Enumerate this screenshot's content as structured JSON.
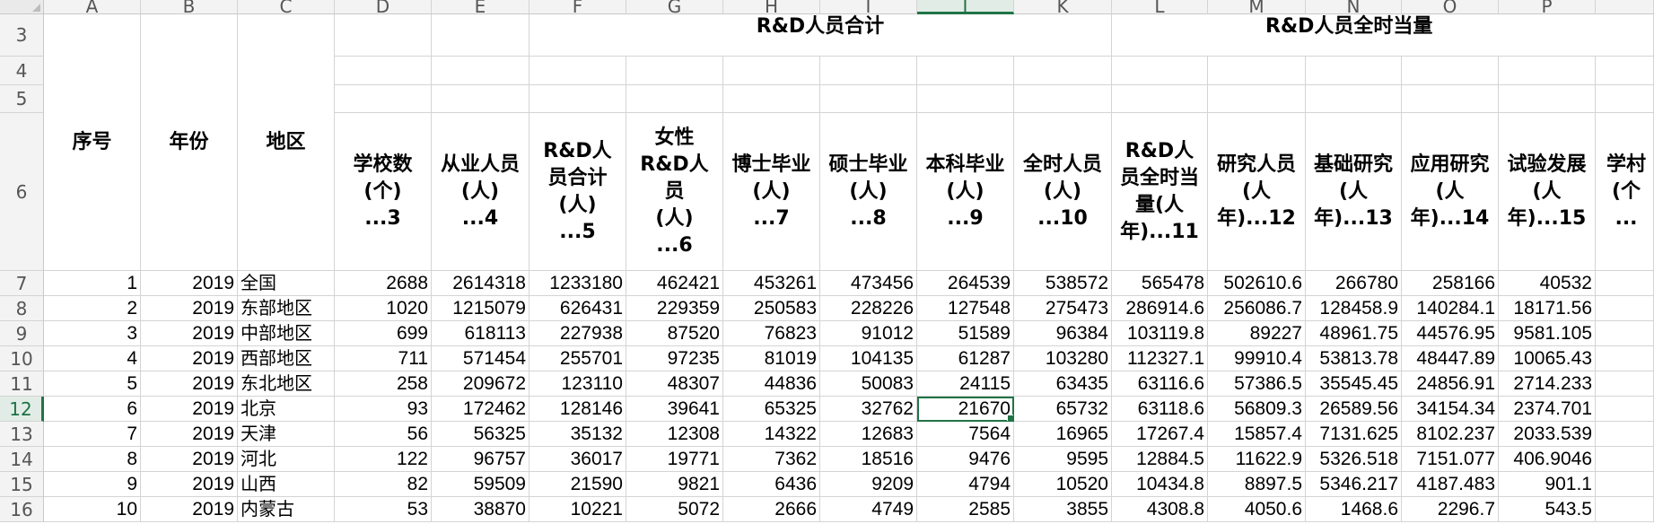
{
  "sheet": {
    "columns": [
      "A",
      "B",
      "C",
      "D",
      "E",
      "F",
      "G",
      "H",
      "I",
      "J",
      "K",
      "L",
      "M",
      "N",
      "O",
      "P"
    ],
    "selected_column": "J",
    "selected_row": "12",
    "group_titles": {
      "rd_total": "R&D人员合计",
      "rd_fte": "R&D人员全时当量"
    },
    "merged_headers": {
      "seq": "序号",
      "year": "年份",
      "region": "地区"
    },
    "headers": [
      "学校数\n(个)\n...3",
      "从业人员\n(人)\n...4",
      "R&D人\n员合计\n(人)\n...5",
      "女性\nR&D人\n员\n(人)\n...6",
      "博士毕业\n(人)\n...7",
      "硕士毕业\n(人)\n...8",
      "本科毕业\n(人)\n...9",
      "全时人员\n(人)\n...10",
      "R&D人\n员全时当\n量(人\n年)...11",
      "研究人员\n(人\n年)...12",
      "基础研究\n(人\n年)...13",
      "应用研究\n(人\n年)...14",
      "试验发展\n(人\n年)...15",
      "学村\n(个\n..."
    ],
    "rows": [
      {
        "row": "7",
        "cells": [
          "1",
          "2019",
          "全国",
          "2688",
          "2614318",
          "1233180",
          "462421",
          "453261",
          "473456",
          "264539",
          "538572",
          "565478",
          "502610.6",
          "266780",
          "258166",
          "40532"
        ]
      },
      {
        "row": "8",
        "cells": [
          "2",
          "2019",
          "东部地区",
          "1020",
          "1215079",
          "626431",
          "229359",
          "250583",
          "228226",
          "127548",
          "275473",
          "286914.6",
          "256086.7",
          "128458.9",
          "140284.1",
          "18171.56"
        ]
      },
      {
        "row": "9",
        "cells": [
          "3",
          "2019",
          "中部地区",
          "699",
          "618113",
          "227938",
          "87520",
          "76823",
          "91012",
          "51589",
          "96384",
          "103119.8",
          "89227",
          "48961.75",
          "44576.95",
          "9581.105"
        ]
      },
      {
        "row": "10",
        "cells": [
          "4",
          "2019",
          "西部地区",
          "711",
          "571454",
          "255701",
          "97235",
          "81019",
          "104135",
          "61287",
          "103280",
          "112327.1",
          "99910.4",
          "53813.78",
          "48447.89",
          "10065.43"
        ]
      },
      {
        "row": "11",
        "cells": [
          "5",
          "2019",
          "东北地区",
          "258",
          "209672",
          "123110",
          "48307",
          "44836",
          "50083",
          "24115",
          "63435",
          "63116.6",
          "57386.5",
          "35545.45",
          "24856.91",
          "2714.233"
        ]
      },
      {
        "row": "12",
        "cells": [
          "6",
          "2019",
          "北京",
          "93",
          "172462",
          "128146",
          "39641",
          "65325",
          "32762",
          "21670",
          "65732",
          "63118.6",
          "56809.3",
          "26589.56",
          "34154.34",
          "2374.701"
        ]
      },
      {
        "row": "13",
        "cells": [
          "7",
          "2019",
          "天津",
          "56",
          "56325",
          "35132",
          "12308",
          "14322",
          "12683",
          "7564",
          "16965",
          "17267.4",
          "15857.4",
          "7131.625",
          "8102.237",
          "2033.539"
        ]
      },
      {
        "row": "14",
        "cells": [
          "8",
          "2019",
          "河北",
          "122",
          "96757",
          "36017",
          "19771",
          "7362",
          "18516",
          "9476",
          "9595",
          "12884.5",
          "11622.9",
          "5326.518",
          "7151.077",
          "406.9046"
        ]
      },
      {
        "row": "15",
        "cells": [
          "9",
          "2019",
          "山西",
          "82",
          "59509",
          "21590",
          "9821",
          "6436",
          "9209",
          "4794",
          "10520",
          "10434.8",
          "8897.5",
          "5346.217",
          "4187.483",
          "901.1"
        ]
      },
      {
        "row": "16",
        "cells": [
          "10",
          "2019",
          "内蒙古",
          "53",
          "38870",
          "10221",
          "5072",
          "2666",
          "4749",
          "2585",
          "3855",
          "4308.8",
          "4050.6",
          "1468.6",
          "2296.7",
          "543.5"
        ]
      }
    ],
    "header_rows": [
      "3",
      "4",
      "5",
      "6"
    ]
  }
}
